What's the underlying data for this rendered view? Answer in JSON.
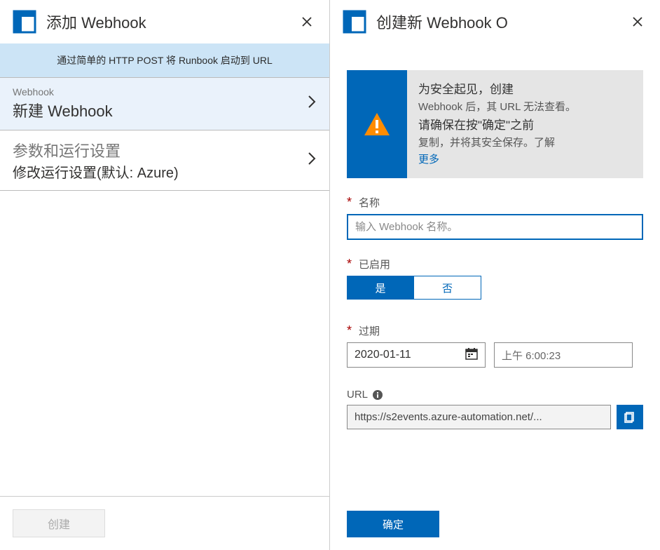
{
  "left": {
    "title": "添加 Webhook",
    "banner": "通过简单的 HTTP POST 将 Runbook 启动到 URL",
    "item1_small": "Webhook",
    "item1_big": "新建 Webhook",
    "item2_top": "参数和运行设置",
    "item2_bottom": "修改运行设置(默认: Azure)",
    "create_label": "创建"
  },
  "right": {
    "title": "创建新 Webhook O",
    "warn_line1": "为安全起见，创建",
    "warn_line2": "Webhook 后，其 URL 无法查看。",
    "warn_line3": "请确保在按\"确定\"之前",
    "warn_line4": "复制，并将其安全保存。了解",
    "warn_more": "更多",
    "name_label": "名称",
    "name_placeholder": "输入 Webhook 名称。",
    "enabled_label": "已启用",
    "toggle_yes": "是",
    "toggle_no": "否",
    "expire_label": "过期",
    "expire_date": "2020-01-11",
    "expire_time": "上午 6:00:23",
    "url_label": "URL",
    "url_value": "https://s2events.azure-automation.net/...",
    "ok_label": "确定"
  }
}
